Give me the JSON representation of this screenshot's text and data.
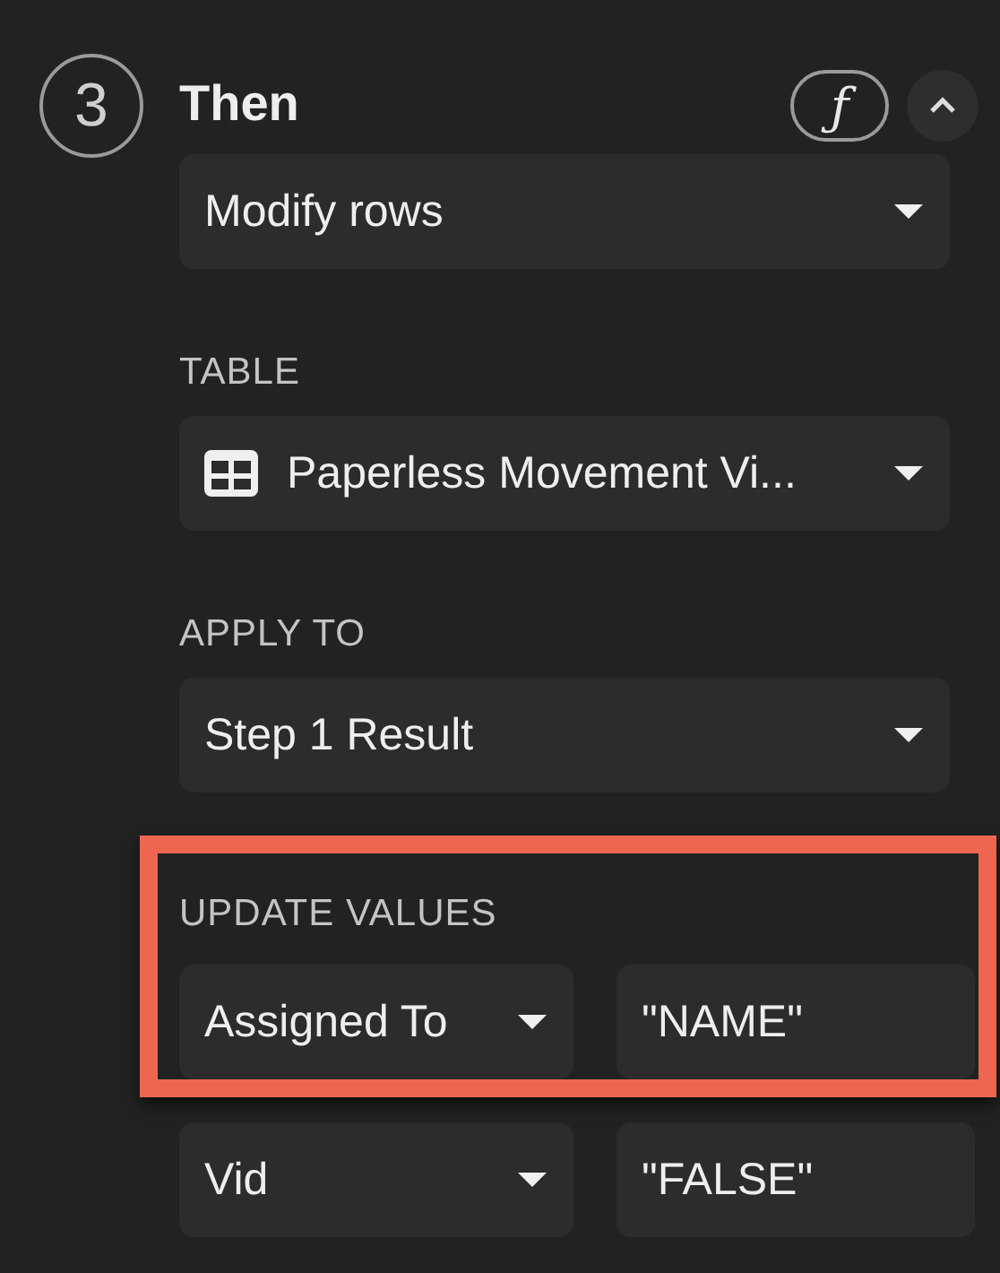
{
  "step": {
    "number": "3",
    "title": "Then"
  },
  "header_buttons": [
    {
      "kind": "formula",
      "label": "ƒ"
    },
    {
      "kind": "collapse"
    }
  ],
  "action": {
    "value": "Modify rows"
  },
  "table": {
    "label": "TABLE",
    "value": "Paperless Movement Vi..."
  },
  "apply_to": {
    "label": "APPLY TO",
    "value": "Step 1 Result"
  },
  "update_values": {
    "label": "UPDATE VALUES",
    "rows": [
      {
        "field": "Assigned To",
        "value": "\"NAME\"",
        "highlighted": true
      },
      {
        "field": "Vid",
        "value": "\"FALSE\"",
        "highlighted": false
      }
    ]
  }
}
